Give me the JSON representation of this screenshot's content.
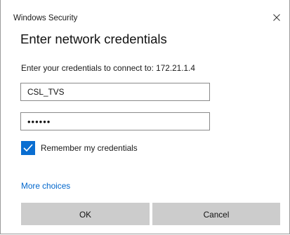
{
  "window": {
    "title": "Windows Security",
    "close_icon": "close-icon"
  },
  "dialog": {
    "heading": "Enter network credentials",
    "description": "Enter your credentials to connect to: 172.21.1.4"
  },
  "form": {
    "username_value": "CSL_TVS",
    "password_masked": "••••••",
    "password_length": 6,
    "remember_label": "Remember my credentials",
    "remember_checked": true
  },
  "links": {
    "more_choices": "More choices"
  },
  "buttons": {
    "ok": "OK",
    "cancel": "Cancel"
  },
  "colors": {
    "accent": "#0a6ed1",
    "link": "#0066cc",
    "button_bg": "#cccccc"
  }
}
